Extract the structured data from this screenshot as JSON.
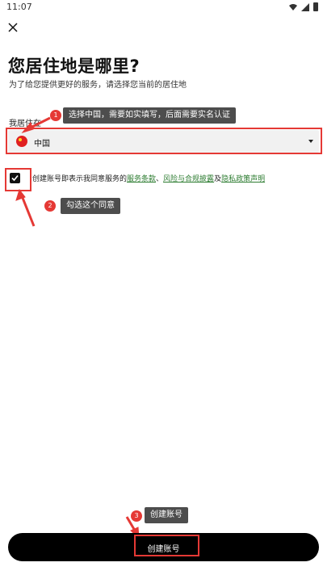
{
  "status_bar": {
    "time": "11:07"
  },
  "header": {
    "title": "您居住地是哪里?",
    "subtitle": "为了给您提供更好的服务，请选择您当前的居住地"
  },
  "form": {
    "residence_label": "我居住在",
    "country_value": "中国",
    "agreement_prefix": "创建账号即表示我同意服务的",
    "link_terms": "服务条款",
    "separator_comma": "、",
    "link_risk": "风险与合规披露",
    "separator_and": "及",
    "link_privacy": "隐私政策声明"
  },
  "footer": {
    "create_account_label": "创建账号"
  },
  "annotations": [
    {
      "number": "1",
      "text": "选择中国，需要如实填写，后面需要实名认证"
    },
    {
      "number": "2",
      "text": "勾选这个同意"
    },
    {
      "number": "3",
      "text": "创建账号"
    }
  ],
  "colors": {
    "highlight": "#e53935",
    "link": "#2e7d32",
    "button": "#000000",
    "annotation_bg": "#4d4d4d"
  }
}
